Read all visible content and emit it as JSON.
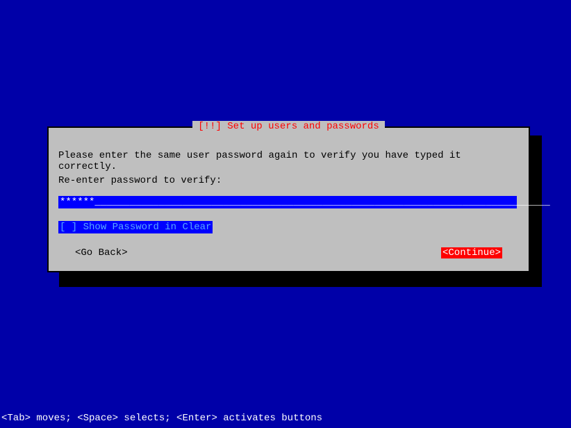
{
  "dialog": {
    "title_priority": "[!!]",
    "title_text": "Set up users and passwords",
    "instruction": "Please enter the same user password again to verify you have typed it correctly.",
    "prompt": "Re-enter password to verify:",
    "password_value": "******",
    "password_fill": "______________________________________________________________________________",
    "checkbox_state": "[ ]",
    "checkbox_label": "Show Password in Clear",
    "go_back_label": "<Go Back>",
    "continue_label": "<Continue>"
  },
  "footer": {
    "help_text": "<Tab> moves; <Space> selects; <Enter> activates buttons"
  },
  "colors": {
    "background": "#0000a8",
    "dialog_bg": "#bfbfbf",
    "input_bg": "#0000ff",
    "accent_red": "#ff0000",
    "checkbox_text": "#57a8ff"
  }
}
